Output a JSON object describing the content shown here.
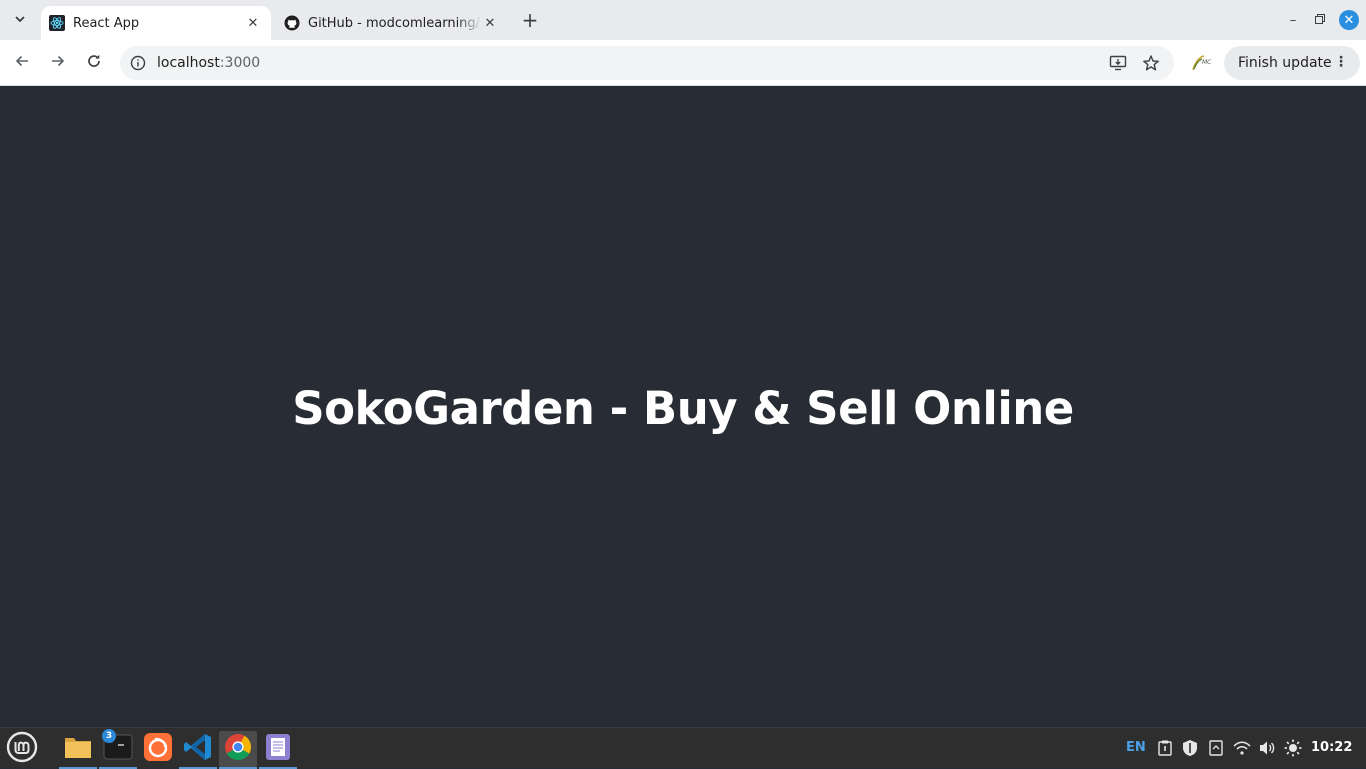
{
  "browser": {
    "tabs": [
      {
        "title": "React App",
        "active": true,
        "favicon": "react-icon"
      },
      {
        "title": "GitHub - modcomlearning/sokogarden",
        "active": false,
        "favicon": "github-icon"
      }
    ],
    "url_host": "localhost",
    "url_port": ":3000",
    "update_button_label": "Finish update"
  },
  "page": {
    "heading": "SokoGarden - Buy & Sell Online",
    "background_color": "#282c34"
  },
  "taskbar": {
    "apps": [
      "files-icon",
      "terminal-icon",
      "firefox-icon",
      "vscode-icon",
      "chrome-icon",
      "text-editor-icon"
    ],
    "terminal_badge": "3",
    "language": "EN",
    "time": "10:22"
  }
}
